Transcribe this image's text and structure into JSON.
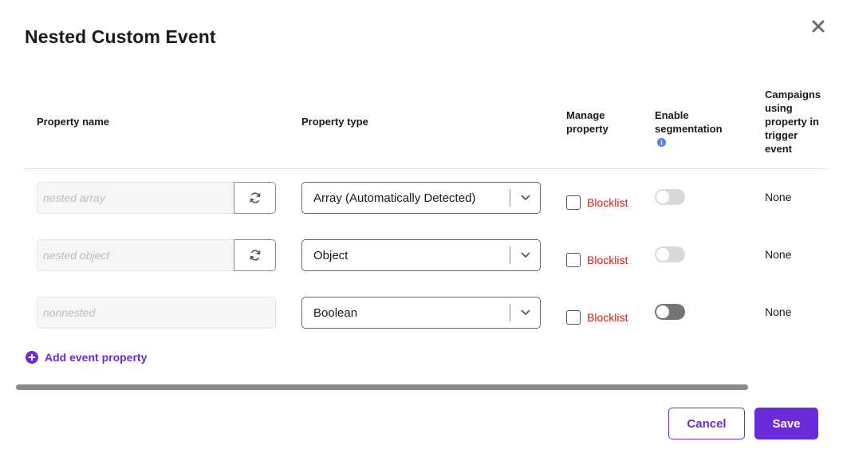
{
  "modal": {
    "title": "Nested Custom Event",
    "close_icon": "close-icon"
  },
  "table": {
    "headers": {
      "property_name": "Property name",
      "property_type": "Property type",
      "manage_property": "Manage property",
      "enable_segmentation": "Enable segmentation",
      "campaigns": "Campaigns using property in trigger event"
    },
    "rows": [
      {
        "name_placeholder": "nested array",
        "has_refresh": true,
        "type": "Array (Automatically Detected)",
        "blocklist_label": "Blocklist",
        "blocklist_checked": false,
        "segmentation": "disabled",
        "campaigns": "None"
      },
      {
        "name_placeholder": "nested object",
        "has_refresh": true,
        "type": "Object",
        "blocklist_label": "Blocklist",
        "blocklist_checked": false,
        "segmentation": "disabled",
        "campaigns": "None"
      },
      {
        "name_placeholder": "nonnested",
        "has_refresh": false,
        "type": "Boolean",
        "blocklist_label": "Blocklist",
        "blocklist_checked": false,
        "segmentation": "off",
        "campaigns": "None"
      }
    ]
  },
  "add_property": {
    "label": "Add event property",
    "icon": "plus-circle-icon"
  },
  "footer": {
    "cancel_label": "Cancel",
    "save_label": "Save"
  },
  "colors": {
    "accent": "#6a2bd9",
    "danger": "#d71a1a",
    "info": "#5b7ee5"
  }
}
